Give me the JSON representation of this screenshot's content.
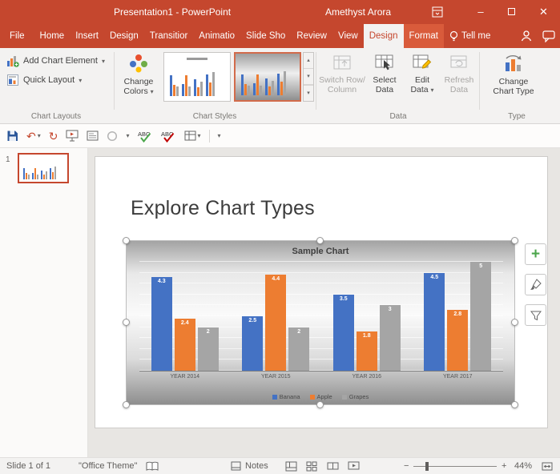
{
  "colors": {
    "brand": "#C5472E",
    "format_tab": "#D95B3B",
    "ribbon_bg": "#F3F2F1",
    "selection_green": "#4CA64C"
  },
  "icons": {
    "undo": "↶",
    "redo": "↻",
    "dropdown": "▾",
    "up": "▴",
    "minimize": "–",
    "close": "✕",
    "zoom_out": "−",
    "zoom_in": "+",
    "plus": "+"
  },
  "title_bar": {
    "title": "Presentation1 - PowerPoint",
    "user": "Amethyst Arora"
  },
  "tabs": [
    {
      "label": "File"
    },
    {
      "label": "Home"
    },
    {
      "label": "Insert"
    },
    {
      "label": "Design"
    },
    {
      "label": "Transitior"
    },
    {
      "label": "Animatio"
    },
    {
      "label": "Slide Sho"
    },
    {
      "label": "Review"
    },
    {
      "label": "View"
    },
    {
      "label": "Design"
    },
    {
      "label": "Format"
    },
    {
      "label": "Tell me"
    }
  ],
  "ribbon": {
    "chart_layouts": {
      "add_chart_element": "Add Chart Element",
      "quick_layout": "Quick Layout",
      "group_label": "Chart Layouts"
    },
    "chart_styles": {
      "change_colors": [
        "Change",
        "Colors"
      ],
      "group_label": "Chart Styles"
    },
    "data": {
      "switch_row": [
        "Switch Row/",
        "Column"
      ],
      "select_data": [
        "Select",
        "Data"
      ],
      "edit_data": [
        "Edit",
        "Data"
      ],
      "refresh_data": [
        "Refresh",
        "Data"
      ],
      "group_label": "Data"
    },
    "type": {
      "change_chart_type": [
        "Change",
        "Chart Type"
      ],
      "group_label": "Type"
    }
  },
  "slide_panel": {
    "slide_number": "1"
  },
  "slide": {
    "title": "Explore Chart Types"
  },
  "chart_data": {
    "type": "bar",
    "title": "Sample Chart",
    "categories": [
      "YEAR 2014",
      "YEAR 2015",
      "YEAR 2016",
      "YEAR 2017"
    ],
    "series": [
      {
        "name": "Banana",
        "color": "#4472C4",
        "values": [
          4.3,
          2.5,
          3.5,
          4.5
        ]
      },
      {
        "name": "Apple",
        "color": "#ED7D31",
        "values": [
          2.4,
          4.4,
          1.8,
          2.8
        ]
      },
      {
        "name": "Grapes",
        "color": "#A5A5A5",
        "values": [
          2,
          2,
          3,
          5
        ]
      }
    ],
    "ylim": [
      0,
      5
    ],
    "grid": true,
    "gridline_step": 0.5,
    "data_labels": true,
    "legend_position": "bottom"
  },
  "status_bar": {
    "slide_count": "Slide 1 of 1",
    "theme": "\"Office Theme\"",
    "notes": "Notes",
    "zoom": "44%"
  }
}
